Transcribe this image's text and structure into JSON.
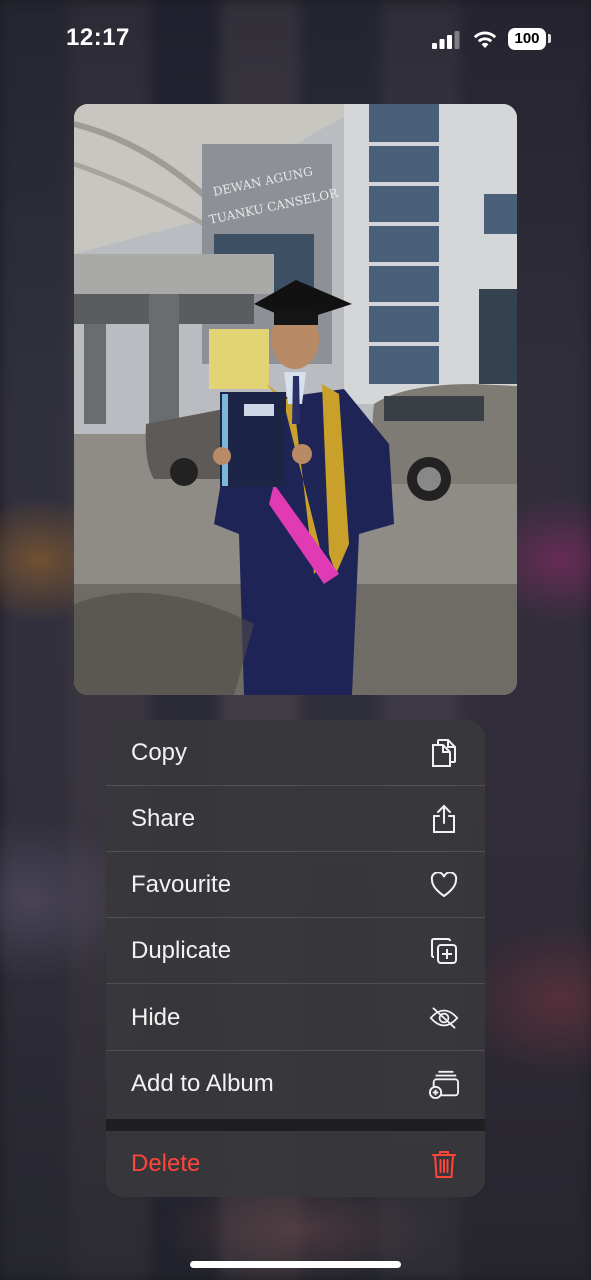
{
  "status_bar": {
    "time": "12:17",
    "battery": "100"
  },
  "photo": {
    "building_sign_line1": "DEWAN AGUNG",
    "building_sign_line2": "TUANKU CANSELOR"
  },
  "menu": {
    "items": [
      {
        "label": "Copy",
        "icon": "copy-icon"
      },
      {
        "label": "Share",
        "icon": "share-icon"
      },
      {
        "label": "Favourite",
        "icon": "heart-icon"
      },
      {
        "label": "Duplicate",
        "icon": "duplicate-icon"
      },
      {
        "label": "Hide",
        "icon": "eye-slash-icon"
      },
      {
        "label": "Add to Album",
        "icon": "add-to-album-icon"
      }
    ],
    "delete": {
      "label": "Delete",
      "icon": "trash-icon"
    }
  },
  "colors": {
    "destructive": "#ff453a",
    "menu_background": "#38383c"
  }
}
